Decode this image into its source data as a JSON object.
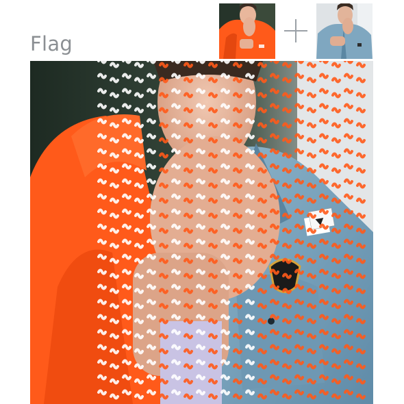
{
  "effect": {
    "title": "Flag"
  },
  "inputs": {
    "source_a_icon": "photo-man-orange-hoodie",
    "source_b_icon": "photo-man-denim-jacket",
    "combine_icon": "plus-icon"
  },
  "result": {
    "icon": "flag-wave-blend-preview"
  },
  "colors": {
    "title_text": "#8b8f93",
    "orange": "#ff5a1a",
    "denim": "#6f9cb8",
    "plus": "#9aa0a6"
  }
}
